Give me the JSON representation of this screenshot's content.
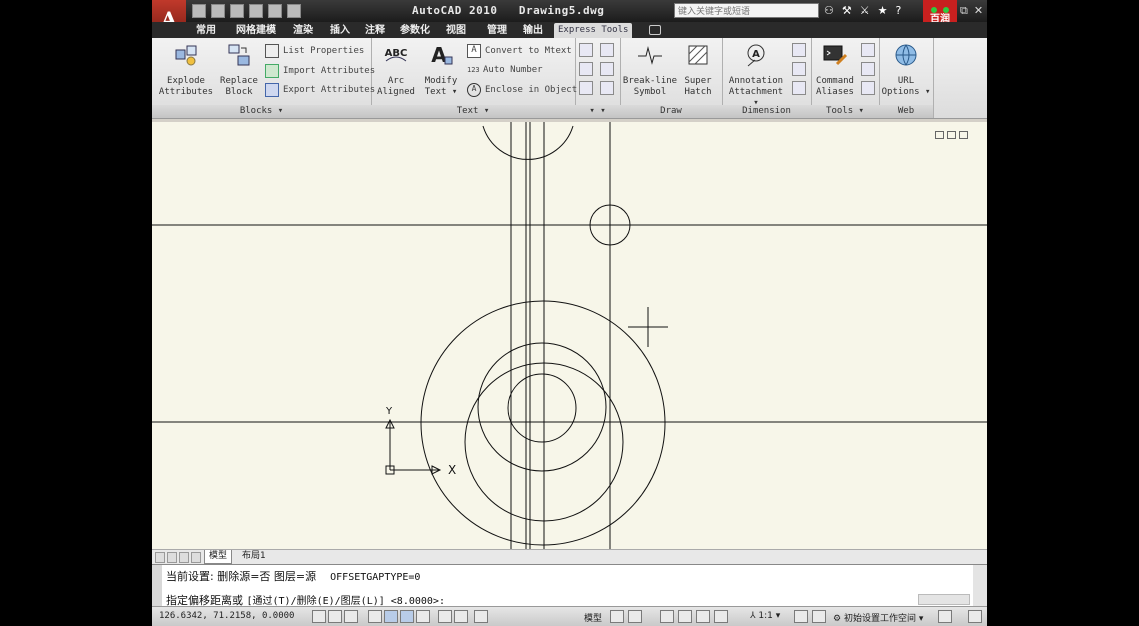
{
  "titlebar": {
    "app_title": "AutoCAD 2010",
    "document": "Drawing5.dwg",
    "search_placeholder": "键入关键字或短语",
    "brand_logo_text": "百润教育"
  },
  "tabs": [
    "常用",
    "网格建模",
    "渲染",
    "插入",
    "注释",
    "参数化",
    "视图",
    "管理",
    "输出",
    "Express Tools"
  ],
  "active_tab": "Express Tools",
  "ribbon": {
    "blocks": {
      "title": "Blocks",
      "explode_line1": "Explode",
      "explode_line2": "Attributes",
      "replace_line1": "Replace",
      "replace_line2": "Block",
      "list_properties": "List Properties",
      "import_attributes": "Import Attributes",
      "export_attributes": "Export Attributes"
    },
    "text": {
      "title": "Text",
      "arc_line1": "Arc",
      "arc_line2": "Aligned",
      "modify_line1": "Modify",
      "modify_line2": "Text",
      "convert": "Convert to Mtext",
      "auto_number": "Auto Number",
      "enclose": "Enclose in Object"
    },
    "draw": {
      "title": "Draw",
      "breakline_line1": "Break-line",
      "breakline_line2": "Symbol",
      "super_line1": "Super",
      "super_line2": "Hatch"
    },
    "dimension": {
      "title": "Dimension",
      "annotation_line1": "Annotation",
      "annotation_line2": "Attachment"
    },
    "tools": {
      "title": "Tools",
      "command_line1": "Command",
      "command_line2": "Aliases"
    },
    "web": {
      "title": "Web",
      "url_line1": "URL",
      "url_line2": "Options"
    }
  },
  "drawing": {
    "ucs_x": "X",
    "ucs_y": "Y"
  },
  "layout_tabs": [
    "模型",
    "布局1"
  ],
  "command": {
    "line1_settings": "当前设置: 删除源=否   图层=源",
    "line1_param": "OFFSETGAPTYPE=0",
    "line2_prompt": "指定偏移距离或",
    "line2_options": "[通过(T)/删除(E)/图层(L)] <8.0000>:"
  },
  "status": {
    "coordinates": "126.6342, 71.2158, 0.0000",
    "model_label": "模型",
    "scale": "1:1",
    "workspace": "初始设置工作空间"
  }
}
